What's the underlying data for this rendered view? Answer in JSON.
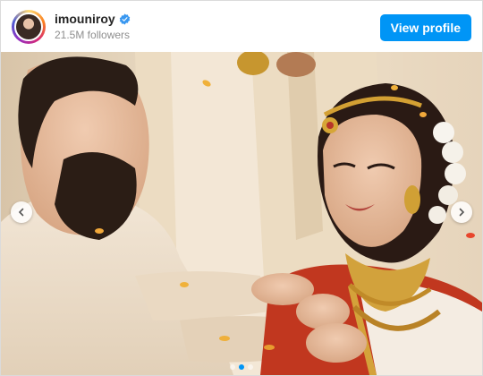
{
  "header": {
    "username": "imouniroy",
    "followers": "21.5M followers",
    "view_profile_label": "View profile"
  },
  "icons": {
    "verified": "verified-badge-icon",
    "prev": "chevron-left-icon",
    "next": "chevron-right-icon"
  },
  "colors": {
    "accent": "#0095f6",
    "verified": "#3897f0"
  },
  "carousel": {
    "slide_count": 3,
    "active_index": 1
  }
}
